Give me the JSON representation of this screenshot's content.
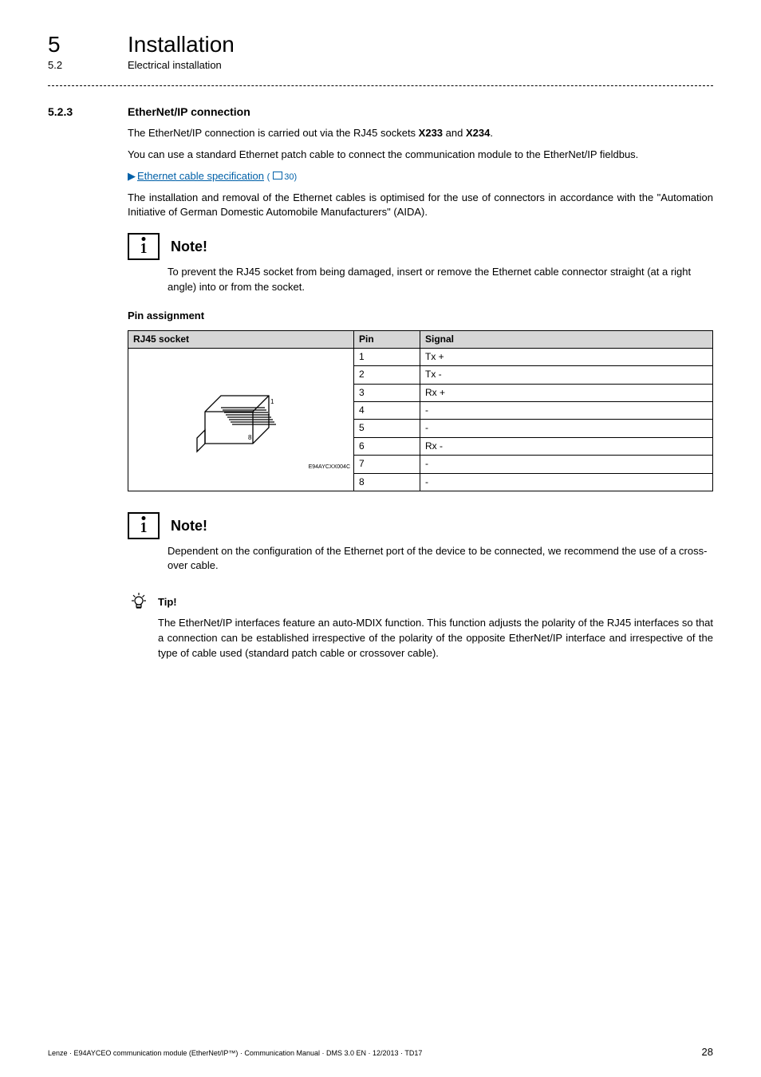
{
  "header": {
    "chapter_number": "5",
    "chapter_title": "Installation",
    "section_number": "5.2",
    "section_title": "Electrical installation"
  },
  "section_5_2_3": {
    "number": "5.2.3",
    "title": "EtherNet/IP connection",
    "para1_pre": "The EtherNet/IP connection is carried out via the RJ45 sockets ",
    "para1_bold1": "X233",
    "para1_mid": " and ",
    "para1_bold2": "X234",
    "para1_post": ".",
    "para2": "You can use a standard Ethernet patch cable to connect the communication module to the EtherNet/IP fieldbus.",
    "link_text": "Ethernet cable specification",
    "link_page": "30",
    "para3": "The installation and removal of the Ethernet cables is optimised for the use of connectors in accordance with the \"Automation Initiative of German Domestic Automobile Manufacturers\" (AIDA)."
  },
  "note1": {
    "label": "Note!",
    "text": "To prevent the RJ45 socket from being damaged, insert or remove the Ethernet cable connector straight (at a right angle) into or from the socket."
  },
  "pin_assignment": {
    "heading": "Pin assignment",
    "col1": "RJ45 socket",
    "col2": "Pin",
    "col3": "Signal",
    "socket_label": "E94AYCXX004C",
    "rows": [
      {
        "pin": "1",
        "signal": "Tx +"
      },
      {
        "pin": "2",
        "signal": "Tx -"
      },
      {
        "pin": "3",
        "signal": "Rx +"
      },
      {
        "pin": "4",
        "signal": "-"
      },
      {
        "pin": "5",
        "signal": "-"
      },
      {
        "pin": "6",
        "signal": "Rx -"
      },
      {
        "pin": "7",
        "signal": "-"
      },
      {
        "pin": "8",
        "signal": "-"
      }
    ]
  },
  "note2": {
    "label": "Note!",
    "text": "Dependent on the configuration of the Ethernet port of the device to be connected, we recommend the use of a cross-over cable."
  },
  "tip": {
    "label": "Tip!",
    "text": "The EtherNet/IP interfaces feature an auto-MDIX function. This function adjusts the polarity of the RJ45 interfaces so that a connection can be established irrespective of the polarity of the opposite EtherNet/IP interface and irrespective of the type of cable used (standard patch cable or crossover cable)."
  },
  "footer": {
    "left": "Lenze · E94AYCEO communication module (EtherNet/IP™) · Communication Manual · DMS 3.0 EN · 12/2013 · TD17",
    "page": "28"
  }
}
